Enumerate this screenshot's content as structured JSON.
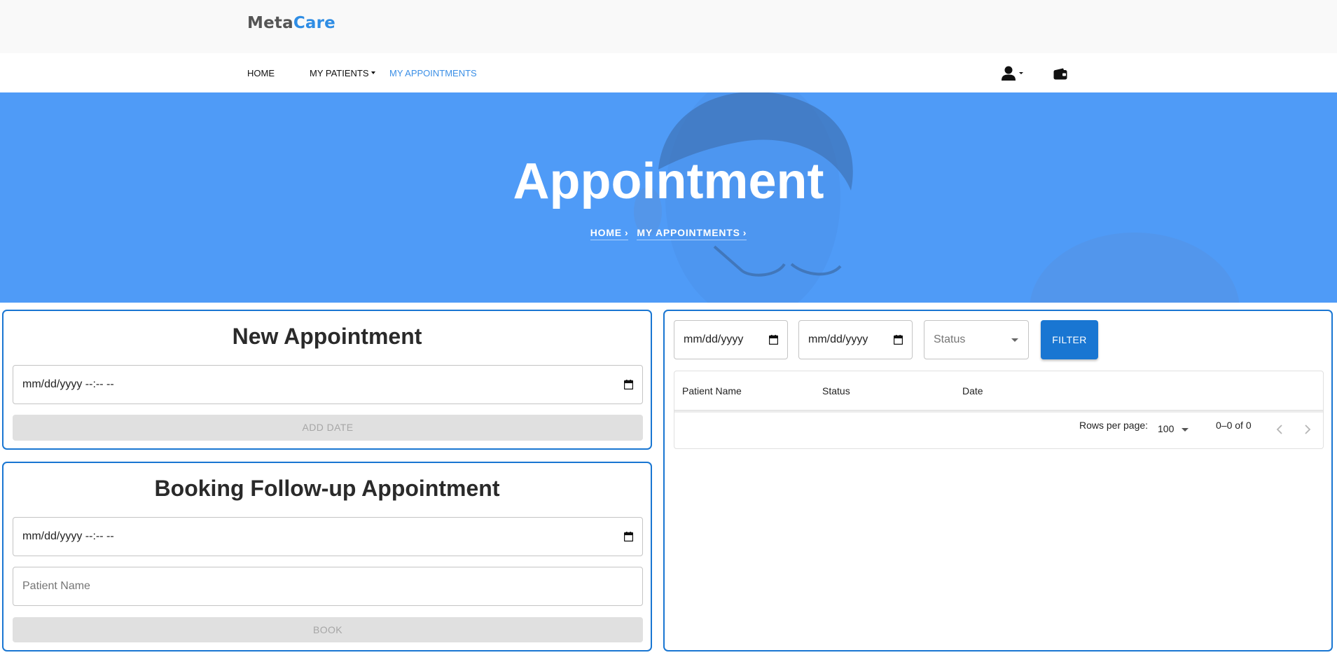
{
  "brand": {
    "part1": "Meta",
    "part2": "Care"
  },
  "nav": {
    "home": "HOME",
    "my_patients": "MY PATIENTS",
    "my_appointments": "MY APPOINTMENTS"
  },
  "hero": {
    "title": "Appointment",
    "breadcrumb": [
      "HOME",
      "MY APPOINTMENTS"
    ]
  },
  "new_appointment": {
    "title": "New Appointment",
    "datetime_value": "mm/dd/yyyy --:-- --",
    "add_button": "ADD DATE"
  },
  "follow_up": {
    "title": "Booking Follow-up Appointment",
    "datetime_value": "mm/dd/yyyy --:-- --",
    "patient_placeholder": "Patient Name",
    "book_button": "BOOK"
  },
  "filters": {
    "from_date": "mm/dd/yyyy",
    "to_date": "mm/dd/yyyy",
    "status_placeholder": "Status",
    "filter_button": "FILTER"
  },
  "table": {
    "columns": [
      "Patient Name",
      "Status",
      "Date"
    ],
    "rows": [],
    "rows_per_page_label": "Rows per page:",
    "rows_per_page_value": "100",
    "pagination_text": "0–0 of 0"
  },
  "colors": {
    "accent": "#1976d2",
    "hero_blue": "#4f9bf7",
    "brand_gray": "#555555",
    "brand_blue": "#2f8de4",
    "nav_active": "#3b8fe6"
  },
  "icons": {
    "user": "user-icon",
    "wallet": "wallet-icon",
    "calendar": "calendar-icon",
    "chevron_left": "chevron-left-icon",
    "chevron_right": "chevron-right-icon"
  }
}
